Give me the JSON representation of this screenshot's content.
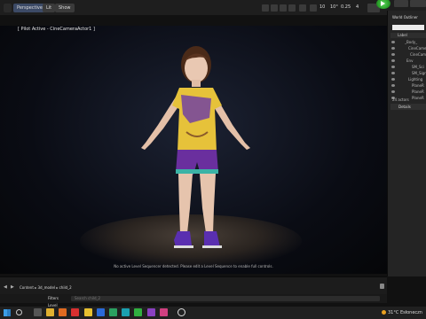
{
  "toolbar": {
    "perspective_label": "Perspective",
    "lit_label": "Lit",
    "show_label": "Show",
    "snap_value": "10",
    "angle_value": "10°",
    "scale_value": "0.25",
    "speed_value": "4"
  },
  "viewport": {
    "pilot_text": "[ Pilot Active - CineCameraActor1 ]",
    "notice_text": "No active Level Sequencer detected. Please edit a Level Sequence to enable full controls."
  },
  "outliner": {
    "title": "World Outliner",
    "label_header": "Label",
    "items": [
      "_Body_",
      "CineCameraActor",
      "CineCameraActor",
      "Env",
      "SM_Sci",
      "SM_Sign",
      "Lighting",
      "PlaneR",
      "PlaneR",
      "PlaneR"
    ],
    "actor_count": "24 actors",
    "details_title": "Details"
  },
  "content_browser": {
    "breadcrumb_root": "Content",
    "breadcrumb_1": "3d_model",
    "breadcrumb_2": "child_2",
    "filters_label": "Filters",
    "search_placeholder": "Search child_2",
    "level_item": "Level"
  },
  "taskbar": {
    "weather": "31°C  Esłoneczn"
  },
  "colors": {
    "accent_green": "#2aa12a",
    "shirt_yellow": "#e6c23a",
    "shirt_purple": "#6b3aa8",
    "shorts_purple": "#6a2f9e"
  }
}
